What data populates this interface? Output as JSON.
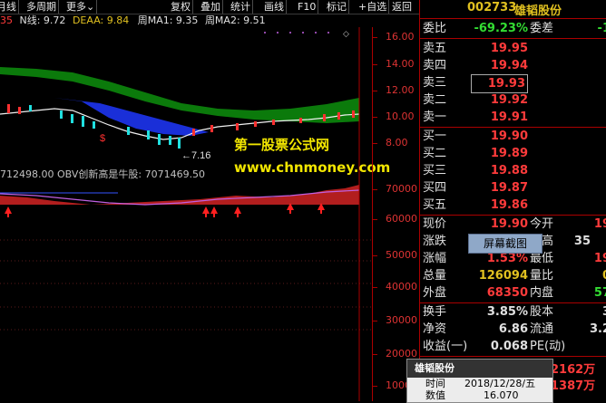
{
  "toolbar": {
    "items": [
      "月线",
      "多周期",
      "更多",
      "复权",
      "叠加",
      "统计",
      "画线",
      "F10",
      "标记",
      "+自选",
      "返回"
    ]
  },
  "indicator": {
    "prefix": "35",
    "n_label": "N线: 9.72",
    "deaa_label": "DEAA: 9.84",
    "ma1_label": "周MA1: 9.35",
    "ma2_label": "周MA2: 9.51"
  },
  "chart": {
    "low_marker": "7.16",
    "dollar_marker": "$",
    "obv_text": "712498.00  OBV创新高是牛股: 7071469.50",
    "price_ticks": [
      "16.00",
      "14.00",
      "12.00",
      "10.00",
      "8.00"
    ],
    "obv_ticks": [
      "70000",
      "60000",
      "50000",
      "40000",
      "30000",
      "20000",
      "10000"
    ],
    "colors": {
      "green_band": "#0b8a0b",
      "blue_band": "#1a2fd8",
      "white_line": "#f0f0f0",
      "obv_red": "#c82020",
      "obv_purple": "#b050e0"
    }
  },
  "watermark": {
    "line1": "第一股票公式网",
    "line2": "www.chnmoney.com"
  },
  "panel": {
    "code": "002733",
    "name": "雄韬股份",
    "webi_label": "委比",
    "webi_value": "-69.23%",
    "weicha_label": "委差",
    "weicha_value": "-1",
    "sells": [
      {
        "label": "卖五",
        "price": "19.95"
      },
      {
        "label": "卖四",
        "price": "19.94"
      },
      {
        "label": "卖三",
        "price": "19.93"
      },
      {
        "label": "卖二",
        "price": "19.92"
      },
      {
        "label": "卖一",
        "price": "19.91"
      }
    ],
    "buys": [
      {
        "label": "买一",
        "price": "19.90"
      },
      {
        "label": "买二",
        "price": "19.89"
      },
      {
        "label": "买三",
        "price": "19.88"
      },
      {
        "label": "买四",
        "price": "19.87"
      },
      {
        "label": "买五",
        "price": "19.86"
      }
    ],
    "stats": [
      {
        "l1": "现价",
        "v1": "19.90",
        "l2": "今开",
        "v2": "19"
      },
      {
        "l1": "涨跌",
        "v1": "",
        "l2": "高",
        "v2": "35"
      },
      {
        "l1": "涨幅",
        "v1": "1.53%",
        "l2": "最低",
        "v2": "19"
      },
      {
        "l1": "总量",
        "v1": "126094",
        "l2": "量比",
        "v2": "0"
      },
      {
        "l1": "外盘",
        "v1": "68350",
        "l2": "内盘",
        "v2": "57"
      },
      {
        "l1": "换手",
        "v1": "3.85%",
        "l2": "股本",
        "v2": "3"
      },
      {
        "l1": "净资",
        "v1": "6.86",
        "l2": "流通",
        "v2": "3.2"
      },
      {
        "l1": "收益(一)",
        "v1": "0.068",
        "l2": "PE(动)",
        "v2": ""
      }
    ],
    "partial_values": [
      "2162万",
      "1387万"
    ]
  },
  "screenshot_button": "屏幕截图",
  "popup": {
    "title": "雄韬股份",
    "rows": [
      {
        "label": "时间",
        "value": "2018/12/28/五"
      },
      {
        "label": "数值",
        "value": "16.070"
      }
    ]
  }
}
